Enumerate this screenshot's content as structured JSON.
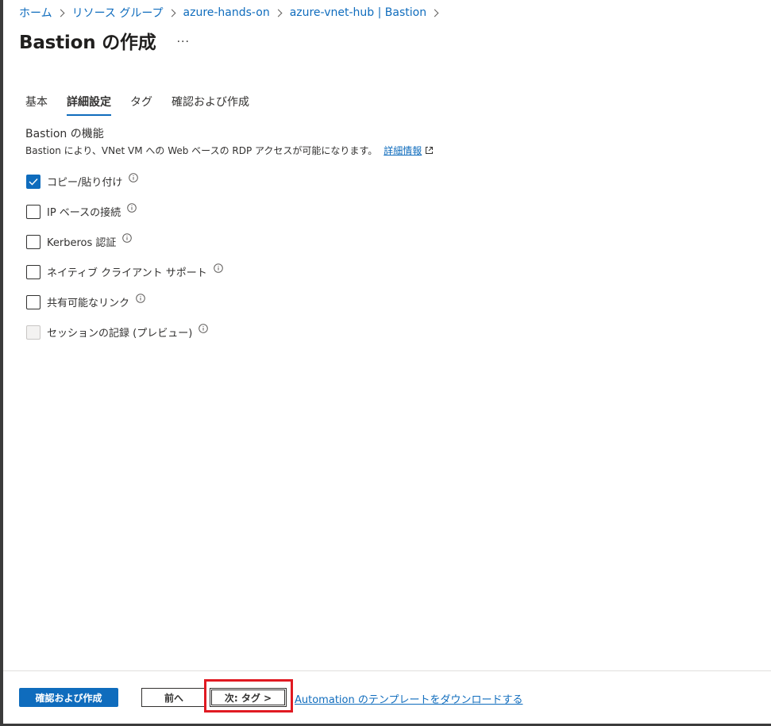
{
  "breadcrumb": [
    "ホーム",
    "リソース グループ",
    "azure-hands-on",
    "azure-vnet-hub | Bastion"
  ],
  "page": {
    "title": "Bastion の作成",
    "more": "···"
  },
  "tabs": [
    {
      "label": "基本",
      "active": false
    },
    {
      "label": "詳細設定",
      "active": true
    },
    {
      "label": "タグ",
      "active": false
    },
    {
      "label": "確認および作成",
      "active": false
    }
  ],
  "section": {
    "title": "Bastion の機能",
    "description": "Bastion により、VNet VM への Web ベースの RDP アクセスが可能になります。",
    "learn_more": "詳細情報"
  },
  "features": [
    {
      "label": "コピー/貼り付け",
      "checked": true,
      "disabled": false
    },
    {
      "label": "IP ベースの接続",
      "checked": false,
      "disabled": false
    },
    {
      "label": "Kerberos 認証",
      "checked": false,
      "disabled": false
    },
    {
      "label": "ネイティブ クライアント サポート",
      "checked": false,
      "disabled": false
    },
    {
      "label": "共有可能なリンク",
      "checked": false,
      "disabled": false
    },
    {
      "label": "セッションの記録 (プレビュー)",
      "checked": false,
      "disabled": true
    }
  ],
  "footer": {
    "review_create": "確認および作成",
    "previous": "前へ",
    "next": "次: タグ >",
    "download_template": "Automation のテンプレートをダウンロードする"
  },
  "colors": {
    "accent": "#0f6cbd",
    "highlight": "#e01a22"
  }
}
